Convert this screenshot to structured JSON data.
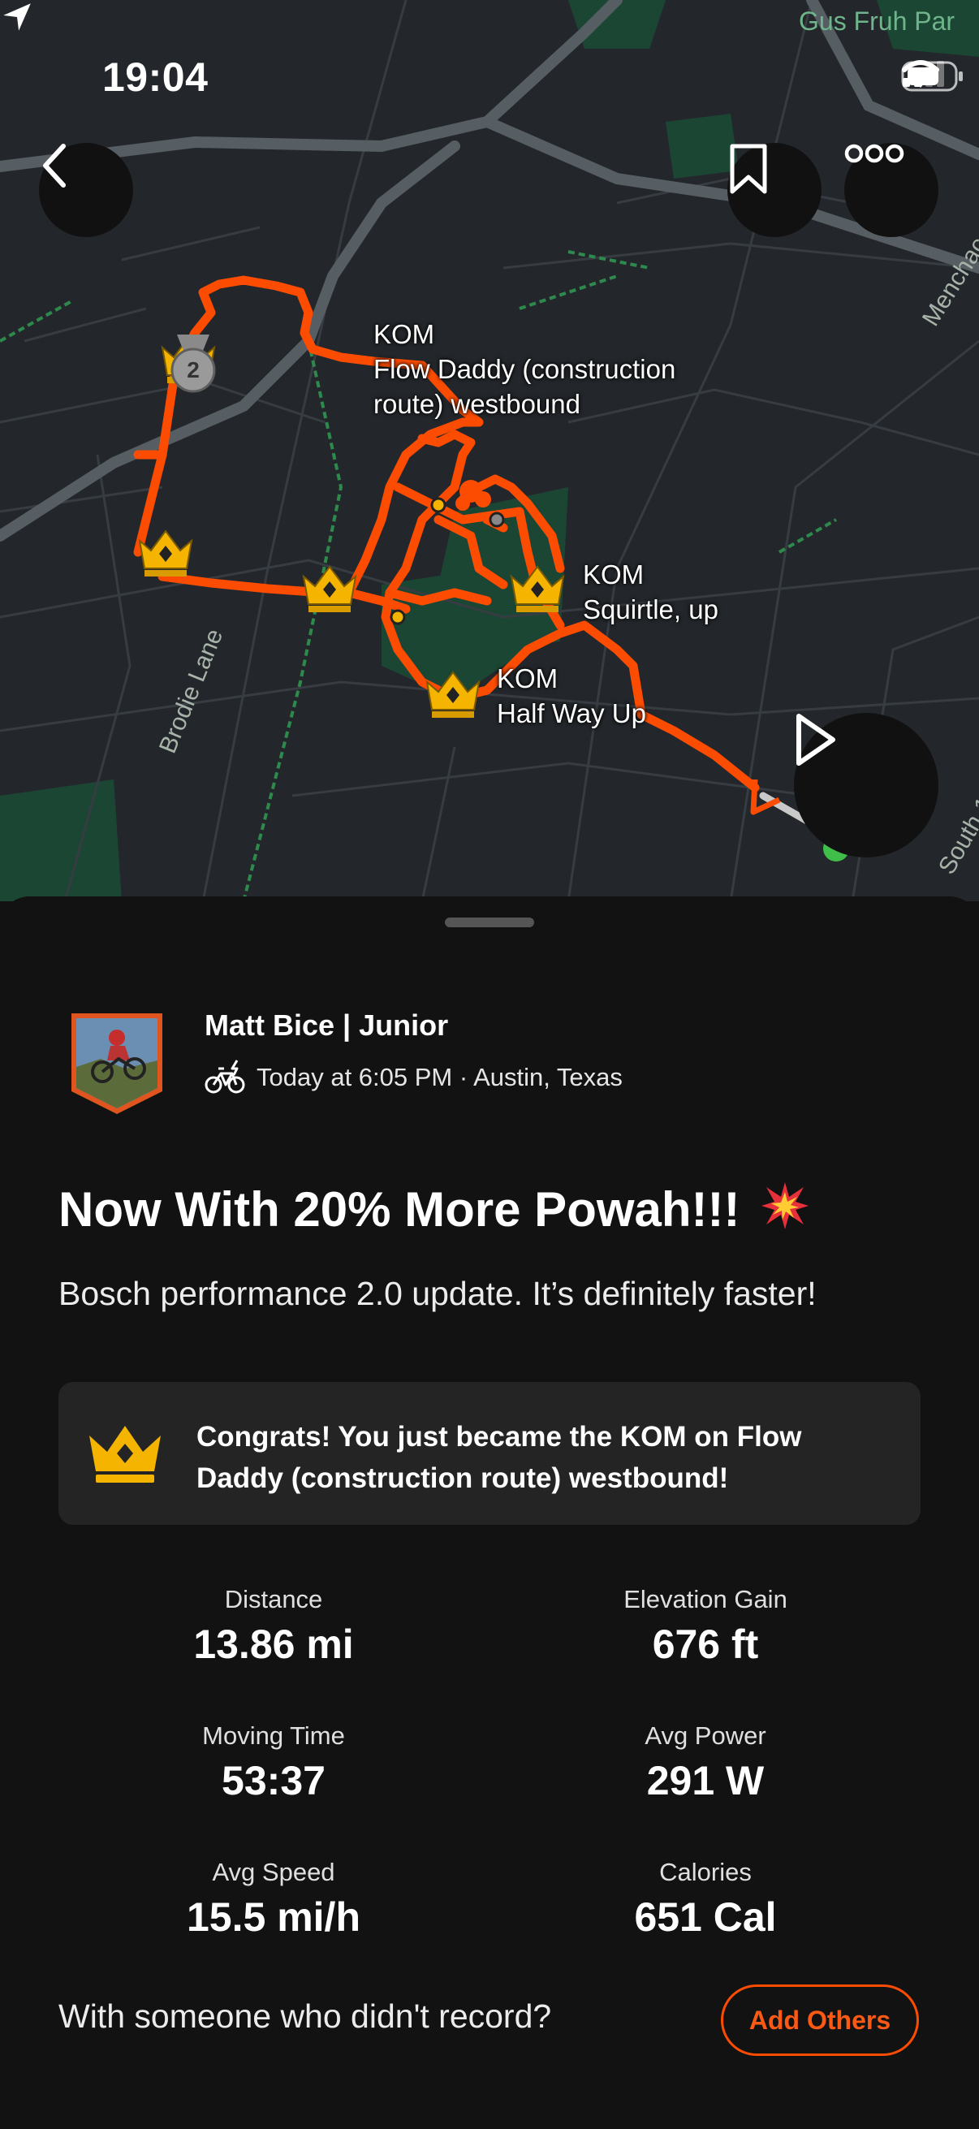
{
  "status_bar": {
    "time": "19:04",
    "icons": [
      "location-arrow-icon",
      "cellular-signal-icon",
      "wifi-icon",
      "battery-icon"
    ]
  },
  "map": {
    "place_label": "Gus Fruh Par",
    "road_labels": [
      "Brodie Lane",
      "Menchac",
      "South 1"
    ],
    "segments": [
      {
        "badge": "KOM",
        "name": "Flow Daddy (construction route) westbound"
      },
      {
        "badge": "KOM",
        "name": "Squirtle, up"
      },
      {
        "badge": "KOM",
        "name": "Half Way Up"
      }
    ],
    "medal_number": "2",
    "colors": {
      "route": "#fc4c02",
      "crown": "#f4b400",
      "map_bg": "#23272b",
      "park": "#1c4a35"
    },
    "buttons": [
      "back-button",
      "save-route-button",
      "more-options-button",
      "play-flyover-button"
    ]
  },
  "activity": {
    "athlete_name": "Matt Bice | Junior",
    "meta": "Today at 6:05 PM · Austin, Texas",
    "activity_type_icon": "ebike-icon",
    "title": "Now With 20% More Powah!!!",
    "title_emoji": "💥",
    "description": "Bosch performance 2.0 update. It’s definitely faster!",
    "kom_message": "Congrats! You just became the KOM on Flow Daddy (construction route) westbound!"
  },
  "stats": [
    {
      "label": "Distance",
      "value": "13.86 mi"
    },
    {
      "label": "Elevation Gain",
      "value": "676 ft"
    },
    {
      "label": "Moving Time",
      "value": "53:37"
    },
    {
      "label": "Avg Power",
      "value": "291 W"
    },
    {
      "label": "Avg Speed",
      "value": "15.5 mi/h"
    },
    {
      "label": "Calories",
      "value": "651 Cal"
    }
  ],
  "footer": {
    "prompt": "With someone who didn't record?",
    "add_others_label": "Add Others"
  },
  "colors": {
    "accent": "#fc4c02",
    "sheet_bg": "#121212",
    "card_bg": "#242424"
  }
}
